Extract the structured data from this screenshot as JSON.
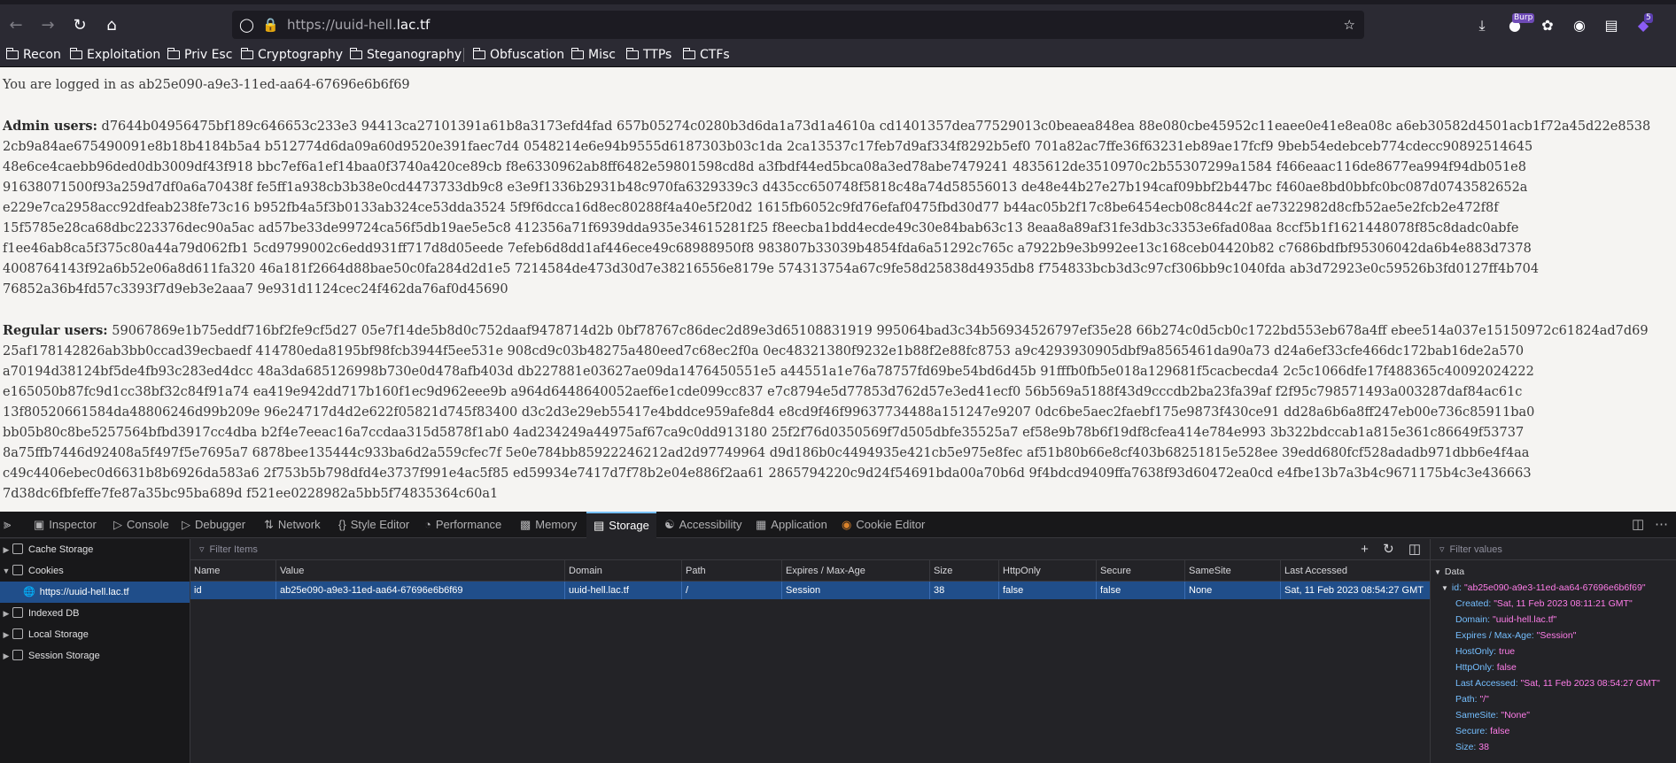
{
  "browser": {
    "url_prefix": "https://uuid-hell.",
    "url_domain": "lac.tf",
    "ext_badge_1": "Burp",
    "ext_badge_2": "5"
  },
  "bookmarks": [
    "Recon",
    "Exploitation",
    "Priv Esc",
    "Cryptography",
    "Steganography",
    "Obfuscation",
    "Misc",
    "TTPs",
    "CTFs"
  ],
  "page": {
    "logged_in_text": "You are logged in as ab25e090-a9e3-11ed-aa64-67696e6b6f69",
    "admin_label": "Admin users:",
    "admin_lines": [
      "d7644b04956475bf189c646653c233e3 94413ca27101391a61b8a3173efd4fad 657b05274c0280b3d6da1a73d1a4610a cd1401357dea77529013c0beaea848ea 88e080cbe45952c11eaee0e41e8ea08c a6eb30582d4501acb1f72a45d22e8538",
      "2cb9a84ae675490091e8b18b4184b5a4 b512774d6da09a60d9520e391faec7d4 0548214e6e94b9555d6187303b03c1da 2ca13537c17feb7d9af334f8292b5ef0 701a82ac7ffe36f63231eb89ae17fcf9 9beb54edebceb774cdecc90892514645",
      "48e6ce4caebb96ded0db3009df43f918 bbc7ef6a1ef14baa0f3740a420ce89cb f8e6330962ab8ff6482e59801598cd8d a3fbdf44ed5bca08a3ed78abe7479241 4835612de3510970c2b55307299a1584 f466eaac116de8677ea994f94db051e8",
      "91638071500f93a259d7df0a6a70438f fe5ff1a938cb3b38e0cd4473733db9c8 e3e9f1336b2931b48c970fa6329339c3 d435cc650748f5818c48a74d58556013 de48e44b27e27b194caf09bbf2b447bc f460ae8bd0bbfc0bc087d0743582652a",
      "e229e7ca2958acc92dfeab238fe73c16 b952fb4a5f3b0133ab324ce53dda3524 5f9f6dcca16d8ec80288f4a40e5f20d2 1615fb6052c9fd76efaf0475fbd30d77 b44ac05b2f17c8be6454ecb08c844c2f ae7322982d8cfb52ae5e2fcb2e472f8f",
      "15f5785e28ca68dbc223376dec90a5ac ad57be33de99724ca56f5db19ae5e5c8 412356a71f6939dda935e34615281f25 f8eecba1bdd4ecde49c30e84bab63c13 8eaa8a89af31fe3db3c3353e6fad08aa 8ccf5b1f1621448078f85c8dadc0abfe",
      "f1ee46ab8ca5f375c80a44a79d062fb1 5cd9799002c6edd931ff717d8d05eede 7efeb6d8dd1af446ece49c68988950f8 983807b33039b4854fda6a51292c765c a7922b9e3b992ee13c168ceb04420b82 c7686bdfbf95306042da6b4e883d7378",
      "4008764143f92a6b52e06a8d611fa320 46a181f2664d88bae50c0fa284d2d1e5 7214584de473d30d7e38216556e8179e 574313754a67c9fe58d25838d4935db8 f754833bcb3d3c97cf306bb9c1040fda ab3d72923e0c59526b3fd0127ff4b704",
      "76852a36b4fd57c3393f7d9eb3e2aaa7 9e931d1124cec24f462da76af0d45690"
    ],
    "regular_label": "Regular users:",
    "regular_lines": [
      "59067869e1b75eddf716bf2fe9cf5d27 05e7f14de5b8d0c752daaf9478714d2b 0bf78767c86dec2d89e3d65108831919 995064bad3c34b56934526797ef35e28 66b274c0d5cb0c1722bd553eb678a4ff ebee514a037e15150972c61824ad7d69",
      "25af178142826ab3bb0ccad39ecbaedf 414780eda8195bf98fcb3944f5ee531e 908cd9c03b48275a480eed7c68ec2f0a 0ec48321380f9232e1b88f2e88fc8753 a9c4293930905dbf9a8565461da90a73 d24a6ef33cfe466dc172bab16de2a570",
      "a70194d38124bf5de4fb93c283ed4dcc 48a3da685126998b730e0d478afb403d db227881e03627ae09da1476450551e5 a44551a1e76a78757fd69be54bd6d45b 91fffb0fb5e018a129681f5cacbecda4 2c5c1066dfe17f488365c40092024222",
      "e165050b87fc9d1cc38bf32c84f91a74 ea419e942dd717b160f1ec9d962eee9b a964d6448640052aef6e1cde099cc837 e7c8794e5d77853d762d57e3ed41ecf0 56b569a5188f43d9cccdb2ba23fa39af f2f95c798571493a003287daf84ac61c",
      "13f80520661584da48806246d99b209e 96e24717d4d2e622f05821d745f83400 d3c2d3e29eb55417e4bddce959afe8d4 e8cd9f46f99637734488a151247e9207 0dc6be5aec2faebf175e9873f430ce91 dd28a6b6a8ff247eb00e736c85911ba0",
      "bb05b80c8be5257564bfbd3917cc4dba b2f4e7eeac16a7ccdaa315d5878f1ab0 4ad234249a44975af67ca9c0dd913180 25f2f76d0350569f7d505dbfe35525a7 ef58e9b78b6f19df8cfea414e784e993 3b322bdccab1a815e361c86649f53737",
      "8a75ffb7446d92408a5f497f5e7695a7 6878bee135444c933ba6d2a559cfec7f 5e0e784bb85922246212ad2d97749964 d9d186b0c4494935e421cb5e975e8fec af51b80b66e8cf403b68251815e528ee 39edd680fcf528adadb971dbb6e4f4aa",
      "c49c4406ebec0d6631b8b6926da583a6 2f753b5b798dfd4e3737f991e4ac5f85 ed59934e7417d7f78b2e04e886f2aa61 2865794220c9d24f54691bda00a70b6d 9f4bdcd9409ffa7638f93d60472ea0cd e4fbe13b7a3b4c9671175b4c3e436663",
      "7d38dc6fbfeffe7fe87a35bc95ba689d f521ee0228982a5bb5f74835364c60a1"
    ]
  },
  "devtools": {
    "tabs": [
      "Inspector",
      "Console",
      "Debugger",
      "Network",
      "Style Editor",
      "Performance",
      "Memory",
      "Storage",
      "Accessibility",
      "Application",
      "Cookie Editor"
    ],
    "active_tab": "Storage",
    "storage_tree": [
      "Cache Storage",
      "Cookies",
      "https://uuid-hell.lac.tf",
      "Indexed DB",
      "Local Storage",
      "Session Storage"
    ],
    "filter_items_placeholder": "Filter Items",
    "filter_values_placeholder": "Filter values",
    "columns": [
      "Name",
      "Value",
      "Domain",
      "Path",
      "Expires / Max-Age",
      "Size",
      "HttpOnly",
      "Secure",
      "SameSite",
      "Last Accessed"
    ],
    "cookie_row": [
      "id",
      "ab25e090-a9e3-11ed-aa64-67696e6b6f69",
      "uuid-hell.lac.tf",
      "/",
      "Session",
      "38",
      "false",
      "false",
      "None",
      "Sat, 11 Feb 2023 08:54:27 GMT"
    ],
    "data_panel": {
      "header": "Data",
      "id_key": "id:",
      "id_value": "\"ab25e090-a9e3-11ed-aa64-67696e6b6f69\"",
      "props": [
        {
          "k": "Created:",
          "v": "\"Sat, 11 Feb 2023 08:11:21 GMT\"",
          "t": "s"
        },
        {
          "k": "Domain:",
          "v": "\"uuid-hell.lac.tf\"",
          "t": "s"
        },
        {
          "k": "Expires / Max-Age:",
          "v": "\"Session\"",
          "t": "s"
        },
        {
          "k": "HostOnly:",
          "v": "true",
          "t": "b"
        },
        {
          "k": "HttpOnly:",
          "v": "false",
          "t": "b"
        },
        {
          "k": "Last Accessed:",
          "v": "\"Sat, 11 Feb 2023 08:54:27 GMT\"",
          "t": "s"
        },
        {
          "k": "Path:",
          "v": "\"/\"",
          "t": "s"
        },
        {
          "k": "SameSite:",
          "v": "\"None\"",
          "t": "s"
        },
        {
          "k": "Secure:",
          "v": "false",
          "t": "b"
        },
        {
          "k": "Size:",
          "v": "38",
          "t": "b"
        }
      ]
    }
  }
}
